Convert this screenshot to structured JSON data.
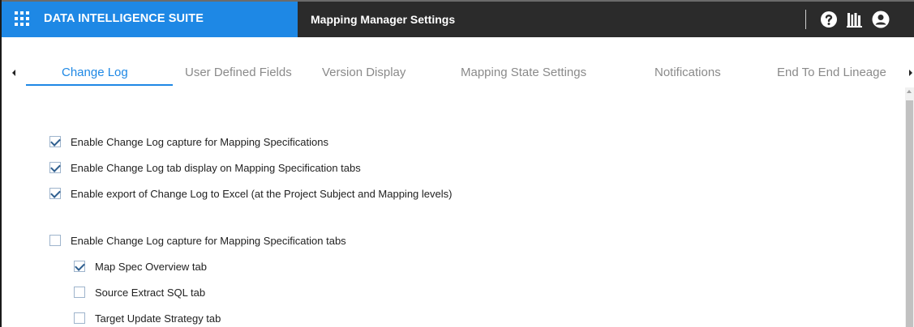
{
  "header": {
    "brand_title": "DATA INTELLIGENCE SUITE",
    "page_title": "Mapping Manager Settings",
    "icons": [
      "apps-grid-icon",
      "help-icon",
      "library-icon",
      "user-account-icon"
    ],
    "brand_color": "#1e88e5",
    "bar_color": "#2b2b2b"
  },
  "tabs": {
    "active_index": 0,
    "items": [
      {
        "label": "Change Log"
      },
      {
        "label": "User Defined Fields"
      },
      {
        "label": "Version Display"
      },
      {
        "label": "Mapping State Settings"
      },
      {
        "label": "Notifications"
      },
      {
        "label": "End To End Lineage"
      }
    ]
  },
  "options": [
    {
      "label": "Enable Change Log capture for Mapping Specifications",
      "checked": true
    },
    {
      "label": "Enable Change Log tab display on Mapping Specification tabs",
      "checked": true
    },
    {
      "label": "Enable export of Change Log to Excel (at the Project Subject and Mapping levels)",
      "checked": true
    },
    {
      "label": "Enable Change Log capture for Mapping Specification tabs",
      "checked": false
    },
    {
      "label": "Map Spec Overview tab",
      "checked": true
    },
    {
      "label": "Source Extract SQL tab",
      "checked": false
    },
    {
      "label": "Target Update Strategy tab",
      "checked": false
    }
  ]
}
